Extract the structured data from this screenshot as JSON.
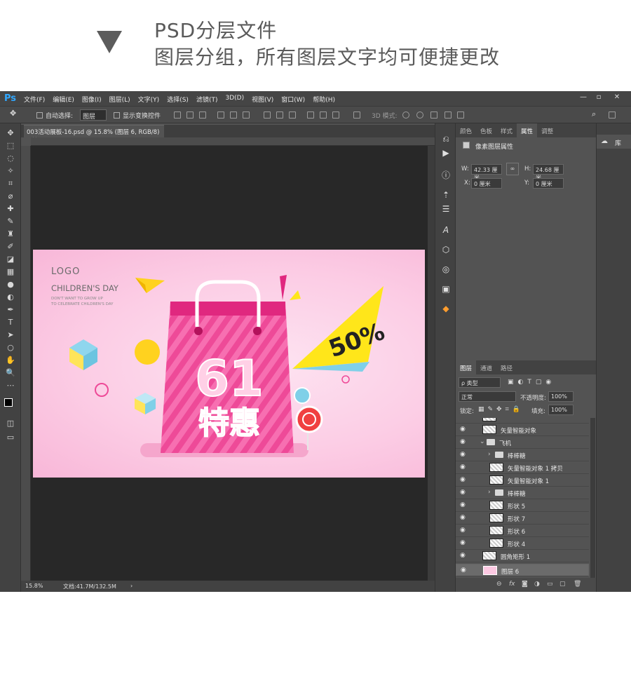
{
  "banner": {
    "line1": "PSD分层文件",
    "line2": "图层分组，所有图层文字均可便捷更改"
  },
  "app": {
    "logo": "Ps",
    "menus": [
      "文件(F)",
      "编辑(E)",
      "图像(I)",
      "图层(L)",
      "文字(Y)",
      "选择(S)",
      "滤镜(T)",
      "3D(D)",
      "视图(V)",
      "窗口(W)",
      "帮助(H)"
    ],
    "window_buttons": [
      "—",
      "▫",
      "✕"
    ]
  },
  "options": {
    "auto_select_label": "自动选择:",
    "auto_select_value": "图层",
    "show_transform_label": "显示变换控件",
    "mode_3d_label": "3D 模式:"
  },
  "document": {
    "tab_title": "003活动展板-16.psd @ 15.8% (图层 6, RGB/8)",
    "zoom": "15.8%",
    "doc_info": "文档:41.7M/132.5M"
  },
  "artwork": {
    "logo": "LOGO",
    "childrens_day": "CHILDREN'S DAY",
    "tagline1": "DON'T WANT TO GROW UP",
    "tagline2": "TO CELEBRATE CHILDREN'S DAY",
    "badge": "50%",
    "number": "61",
    "promo": "特惠"
  },
  "properties": {
    "tabs": [
      "颜色",
      "色板",
      "样式",
      "属性",
      "调整"
    ],
    "header": "像素图层属性",
    "w_label": "W:",
    "w_value": "42.33 厘米",
    "h_label": "H:",
    "h_value": "24.68 厘米",
    "x_label": "X:",
    "x_value": "0 厘米",
    "y_label": "Y:",
    "y_value": "0 厘米"
  },
  "layers": {
    "tabs": [
      "图层",
      "通道",
      "路径"
    ],
    "filter_kind": "ρ 类型",
    "blend_mode": "正常",
    "opacity_label": "不透明度:",
    "opacity_value": "100%",
    "lock_label": "锁定:",
    "fill_label": "填充:",
    "fill_value": "100%",
    "items": [
      {
        "name": "矢量智能对象"
      },
      {
        "name": "飞机"
      },
      {
        "name": "棒棒糖"
      },
      {
        "name": "矢量智能对象 1 拷贝"
      },
      {
        "name": "矢量智能对象 1"
      },
      {
        "name": "棒棒糖"
      },
      {
        "name": "形状 5"
      },
      {
        "name": "形状 7"
      },
      {
        "name": "形状 6"
      },
      {
        "name": "形状 4"
      },
      {
        "name": "圆角矩形 1"
      },
      {
        "name": "图层 6"
      }
    ]
  },
  "library_label": "库"
}
